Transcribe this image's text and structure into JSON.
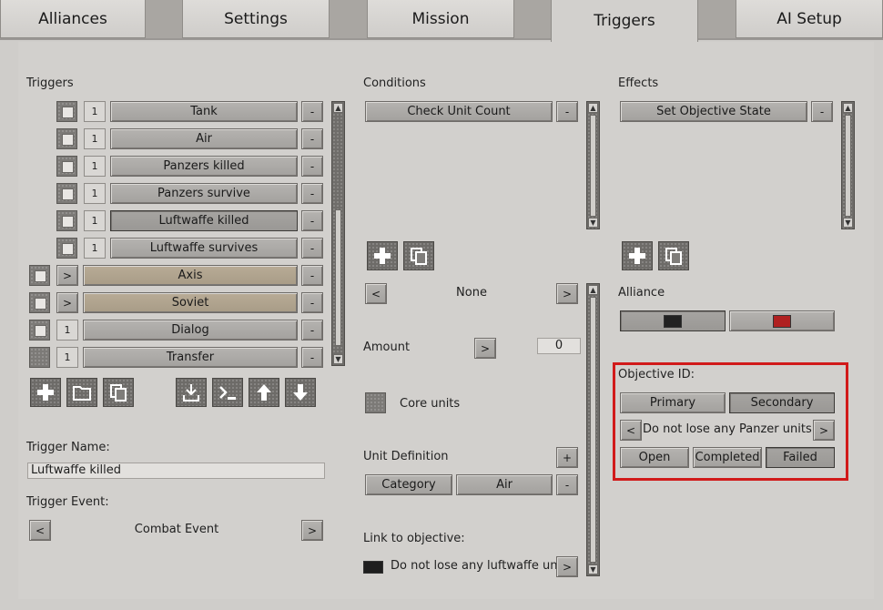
{
  "tabs": [
    {
      "label": "Alliances",
      "active": false
    },
    {
      "label": "Settings",
      "active": false
    },
    {
      "label": "Mission",
      "active": false
    },
    {
      "label": "Triggers",
      "active": true
    },
    {
      "label": "AI Setup",
      "active": false
    }
  ],
  "triggers": {
    "heading": "Triggers",
    "items": [
      {
        "count": "1",
        "label": "Tank",
        "checked": true,
        "selected": false
      },
      {
        "count": "1",
        "label": "Air",
        "checked": true,
        "selected": false
      },
      {
        "count": "1",
        "label": "Panzers killed",
        "checked": true,
        "selected": false
      },
      {
        "count": "1",
        "label": "Panzers survive",
        "checked": true,
        "selected": false
      },
      {
        "count": "1",
        "label": "Luftwaffe killed",
        "checked": true,
        "selected": true
      },
      {
        "count": "1",
        "label": "Luftwaffe survives",
        "checked": true,
        "selected": false
      }
    ],
    "groups": [
      {
        "expand": ">",
        "label": "Axis",
        "checked": true
      },
      {
        "expand": ">",
        "label": "Soviet",
        "checked": true
      }
    ],
    "extra": [
      {
        "count": "1",
        "label": "Dialog",
        "checked": true
      },
      {
        "count": "1",
        "label": "Transfer",
        "checked": false
      }
    ],
    "remove_label": "-",
    "name_label": "Trigger Name:",
    "name_value": "Luftwaffe killed",
    "event_label": "Trigger Event:",
    "event_prev": "<",
    "event_value": "Combat Event",
    "event_next": ">"
  },
  "conditions": {
    "heading": "Conditions",
    "items": [
      {
        "label": "Check Unit Count"
      }
    ],
    "remove_label": "-",
    "selector_prev": "<",
    "selector_value": "None",
    "selector_next": ">",
    "amount_label": "Amount",
    "amount_btn": ">",
    "amount_value": "0",
    "core_units_label": "Core units",
    "unit_def_label": "Unit Definition",
    "unit_def_add": "+",
    "unit_def_remove": "-",
    "category_label": "Category",
    "category_value": "Air",
    "link_label": "Link to objective:",
    "link_value": "Do not lose any luftwaffe units.",
    "link_next": ">"
  },
  "effects": {
    "heading": "Effects",
    "items": [
      {
        "label": "Set Objective State"
      }
    ],
    "remove_label": "-",
    "alliance_label": "Alliance",
    "alliance_colors": [
      "#222222",
      "#b02020"
    ],
    "objective_label": "Objective ID:",
    "primary_label": "Primary",
    "secondary_label": "Secondary",
    "objective_prev": "<",
    "objective_value": "Do not lose any Panzer units.",
    "objective_next": ">",
    "state_open": "Open",
    "state_completed": "Completed",
    "state_failed": "Failed"
  }
}
